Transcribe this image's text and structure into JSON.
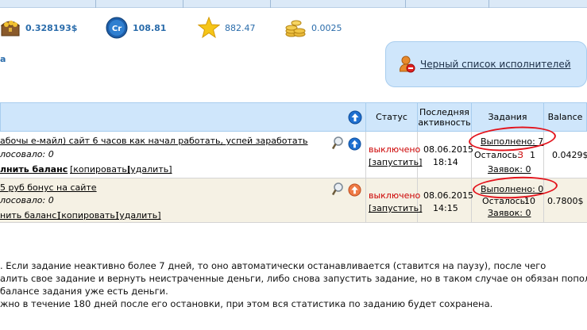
{
  "balances": [
    {
      "icon": "treasure-chest-icon",
      "value": "0.328193$"
    },
    {
      "icon": "cr-coin-icon",
      "value": "108.81"
    },
    {
      "icon": "star-icon",
      "value": "882.47"
    },
    {
      "icon": "coin-stack-icon",
      "value": "0.0025"
    }
  ],
  "left_link": "а",
  "blacklist": {
    "label": "Черный список исполнителей",
    "icon": "user-ban-icon"
  },
  "table": {
    "headers": {
      "status": "Статус",
      "last_activity": "Последняя активность",
      "tasks": "Задания",
      "balance": "Balance"
    },
    "rows": [
      {
        "title": "абочы е-майл) сайт 6 часов как начал работать, успей заработать",
        "voted": "лосовало: 0",
        "action_main": "лнить баланс",
        "copy": "[копировать]",
        "delete": "[удалить]",
        "status": "выключено",
        "start": "[запустить]",
        "date": "08.06.2015",
        "time": "18:14",
        "done": "Выполнено: 7",
        "left_label": "Осталось:",
        "left_value": "3",
        "left_extra": "1",
        "requests": "Заявок: 0",
        "balance": "0.0429$",
        "arrow": "up"
      },
      {
        "title": "5 руб бонус на сайте",
        "voted": "лосовало: 0",
        "action_main": "нить баланс]",
        "copy": "[копировать]",
        "delete": "[удалить]",
        "status": "выключено",
        "start": "[запустить]",
        "date": "08.06.2015",
        "time": "14:15",
        "done": "Выполнено: 0",
        "left_label": "Осталось:",
        "left_value": "10",
        "requests": "Заявок: 0",
        "balance": "0.7800$",
        "arrow": "down"
      }
    ]
  },
  "notes": [
    ". Если задание неактивно более 7 дней, то оно автоматически останавливается (ставится на паузу), после чего",
    "алить свое задание и вернуть неистраченные деньги, либо снова запустить задание, но в таком случае он обязан пополнить",
    "балансе задания уже есть деньги.",
    "жно в течение 180 дней после его остановки, при этом вся статистика по заданию будет сохранена."
  ],
  "colors": {
    "header_bg": "#cfe6fb",
    "status_off": "#cc0000",
    "link": "#1e4e8c",
    "annotation": "#e3131c"
  }
}
